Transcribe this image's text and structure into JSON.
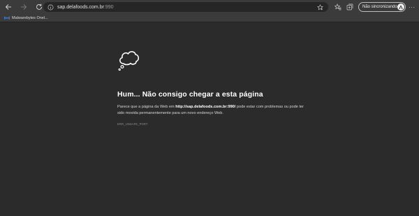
{
  "browser": {
    "address": {
      "host": "sap.delafoods.com.br",
      "port": ":990"
    },
    "profile_label": "Não sincronizando",
    "favorites": [
      {
        "label": "Malwarebytes Onel..."
      }
    ]
  },
  "error_page": {
    "title": "Hum... Não consigo chegar a esta página",
    "desc_before": "Parece que a página da Web em ",
    "desc_url": "http://sap.delafoods.com.br:990/",
    "desc_after": " pode estar com problemas ou pode ter sido movida permanentemente para um novo endereço Web.",
    "error_code": "ERR_UNSAFE_PORT"
  }
}
